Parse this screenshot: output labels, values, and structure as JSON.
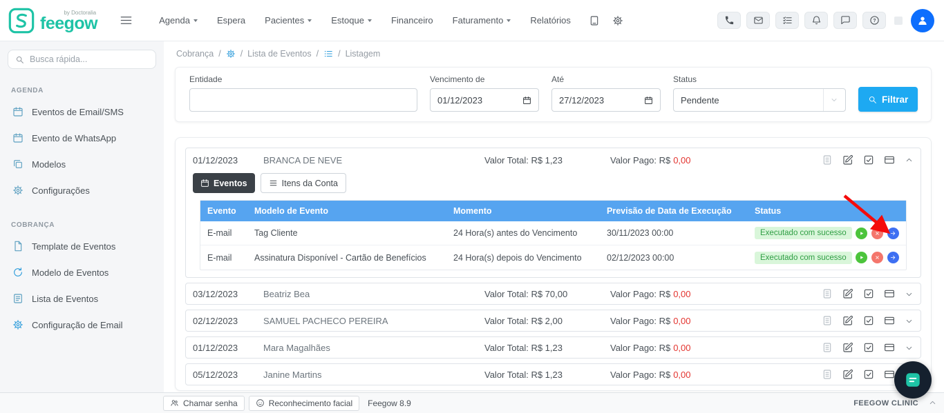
{
  "topbar": {
    "brand": {
      "name": "feegow",
      "byline": "by Doctoralia"
    },
    "menu": [
      {
        "label": "Agenda",
        "caret": true
      },
      {
        "label": "Espera",
        "caret": false
      },
      {
        "label": "Pacientes",
        "caret": true
      },
      {
        "label": "Estoque",
        "caret": true
      },
      {
        "label": "Financeiro",
        "caret": false
      },
      {
        "label": "Faturamento",
        "caret": true
      },
      {
        "label": "Relatórios",
        "caret": false
      }
    ],
    "icon_names": [
      "device-icon",
      "gear-icon",
      "phone-icon",
      "inbox-icon",
      "tasks-icon",
      "bell-icon",
      "chat-icon",
      "help-icon",
      "user-avatar-icon"
    ]
  },
  "sidebar": {
    "search_placeholder": "Busca rápida...",
    "sections": [
      {
        "title": "AGENDA",
        "items": [
          {
            "label": "Eventos de Email/SMS",
            "icon": "calendar-icon"
          },
          {
            "label": "Evento de WhatsApp",
            "icon": "calendar-icon"
          },
          {
            "label": "Modelos",
            "icon": "copy-icon"
          },
          {
            "label": "Configurações",
            "icon": "gears-icon"
          }
        ]
      },
      {
        "title": "COBRANÇA",
        "items": [
          {
            "label": "Template de Eventos",
            "icon": "file-icon"
          },
          {
            "label": "Modelo de Eventos",
            "icon": "refresh-icon"
          },
          {
            "label": "Lista de Eventos",
            "icon": "document-icon"
          },
          {
            "label": "Configuração de Email",
            "icon": "gear-icon"
          }
        ]
      }
    ]
  },
  "breadcrumb": {
    "part1": "Cobrança",
    "part2": "Lista de Eventos",
    "part3": "Listagem",
    "separator": "/"
  },
  "filters": {
    "entity_label": "Entidade",
    "entity_value": "",
    "due_from_label": "Vencimento de",
    "due_from_value": "01/12/2023",
    "due_to_label": "Até",
    "due_to_value": "27/12/2023",
    "status_label": "Status",
    "status_value": "Pendente",
    "filter_button_label": "Filtrar"
  },
  "tabs": {
    "events": "Eventos",
    "account_items": "Itens da Conta"
  },
  "events_table": {
    "headers": {
      "evento": "Evento",
      "modelo": "Modelo de Evento",
      "momento": "Momento",
      "previsao": "Previsão de Data de Execução",
      "status": "Status"
    },
    "rows": [
      {
        "evento": "E-mail",
        "modelo": "Tag Cliente",
        "momento": "24 Hora(s) antes do Vencimento",
        "previsao": "30/11/2023 00:00",
        "status": "Executado com sucesso"
      },
      {
        "evento": "E-mail",
        "modelo": "Assinatura Disponível - Cartão de Benefícios",
        "momento": "24 Hora(s) depois do Vencimento",
        "previsao": "02/12/2023 00:00",
        "status": "Executado com sucesso"
      }
    ],
    "row_action_icons": [
      "play-icon",
      "cancel-icon",
      "resend-icon"
    ]
  },
  "accounts": [
    {
      "date": "01/12/2023",
      "name": "BRANCA DE NEVE",
      "total": "Valor Total: R$ 1,23",
      "paid_prefix": "Valor Pago: R$",
      "paid_value": "0,00"
    },
    {
      "date": "03/12/2023",
      "name": "Beatriz Bea",
      "total": "Valor Total: R$ 70,00",
      "paid_prefix": "Valor Pago: R$",
      "paid_value": "0,00"
    },
    {
      "date": "02/12/2023",
      "name": "SAMUEL PACHECO PEREIRA",
      "total": "Valor Total: R$ 2,00",
      "paid_prefix": "Valor Pago: R$",
      "paid_value": "0,00"
    },
    {
      "date": "01/12/2023",
      "name": "Mara Magalhães",
      "total": "Valor Total: R$ 1,23",
      "paid_prefix": "Valor Pago: R$",
      "paid_value": "0,00"
    },
    {
      "date": "05/12/2023",
      "name": "Janine Martins",
      "total": "Valor Total: R$ 1,23",
      "paid_prefix": "Valor Pago: R$",
      "paid_value": "0,00"
    }
  ],
  "footer": {
    "call_ticket": "Chamar senha",
    "face_recognition": "Reconhecimento facial",
    "version": "Feegow 8.9",
    "clinic_name": "FEEGOW CLINIC"
  },
  "colors": {
    "brand_teal": "#1ec3a6",
    "primary_blue": "#1da9f2",
    "table_header_blue": "#56a4f0",
    "success_badge_bg": "#d9f6da",
    "success_badge_text": "#2f9e44",
    "danger_red": "#e3342f",
    "annotation_arrow": "#f40b0b"
  }
}
